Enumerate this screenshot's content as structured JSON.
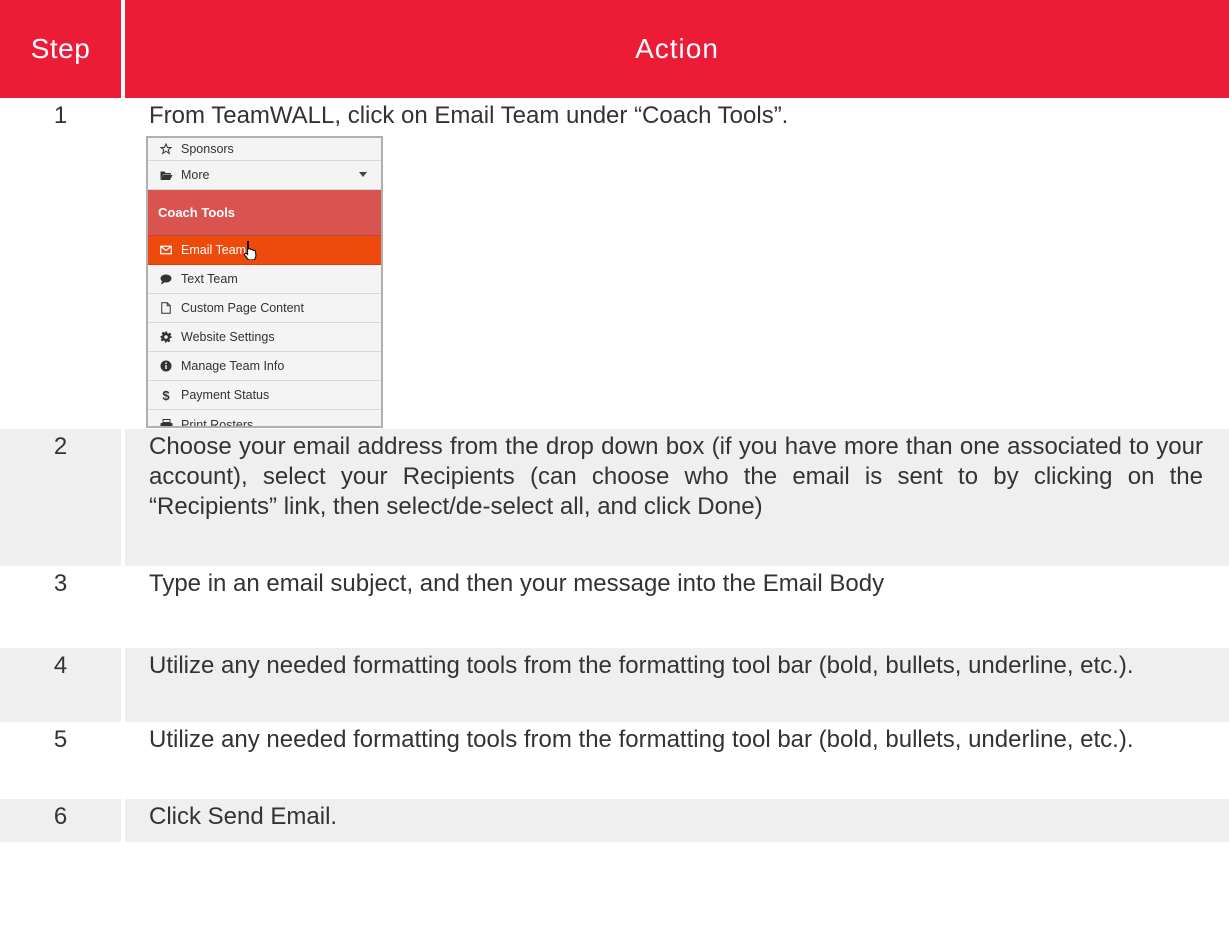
{
  "header": {
    "step_label": "Step",
    "action_label": "Action"
  },
  "rows": [
    {
      "step": "1",
      "text": "From TeamWALL, click on Email Team under “Coach Tools”."
    },
    {
      "step": "2",
      "text": "Choose your email address from the drop down box (if you have more than one associated to your account), select your Recipients (can choose who the email is sent to by clicking on the “Recipients” link, then select/de-select all, and click Done)"
    },
    {
      "step": "3",
      "text": "Type in an email subject, and then your message into the Email Body"
    },
    {
      "step": "4",
      "text": "Utilize any needed formatting tools from the formatting tool bar (bold, bullets, underline, etc.)."
    },
    {
      "step": "5",
      "text": "Utilize any needed formatting tools from the formatting tool bar (bold, bullets, underline, etc.)."
    },
    {
      "step": "6",
      "text": "Click Send Email."
    }
  ],
  "menu": {
    "items_top": [
      {
        "label": "Sponsors",
        "icon": "star-icon"
      },
      {
        "label": "More",
        "icon": "folder-open-icon"
      }
    ],
    "section_label": "Coach Tools",
    "items": [
      {
        "label": "Email Team",
        "icon": "envelope-icon",
        "active": true
      },
      {
        "label": "Text Team",
        "icon": "comment-icon"
      },
      {
        "label": "Custom Page Content",
        "icon": "file-icon"
      },
      {
        "label": "Website Settings",
        "icon": "cog-icon"
      },
      {
        "label": "Manage Team Info",
        "icon": "info-circle-icon"
      },
      {
        "label": "Payment Status",
        "icon": "dollar-icon"
      },
      {
        "label": "Print Rosters",
        "icon": "print-icon"
      }
    ],
    "colors": {
      "header_red": "#ed1c36",
      "section_red": "#d9534f",
      "active_orange": "#ee4a0d"
    }
  }
}
